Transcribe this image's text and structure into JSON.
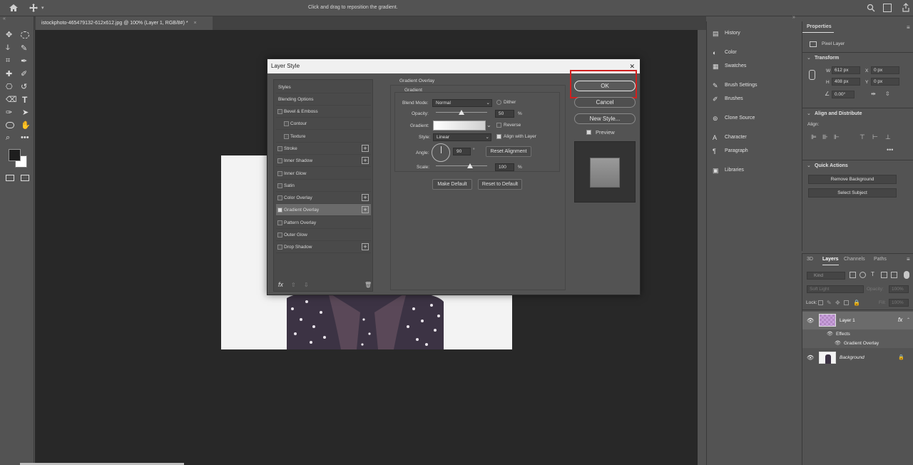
{
  "option_bar": {
    "hint": "Click and drag to reposition the gradient.",
    "icons": [
      "home-icon",
      "move-icon",
      "search-icon",
      "workspace-icon",
      "share-icon"
    ]
  },
  "document": {
    "tab_title": "istockphoto-465479132-612x612.jpg @ 100% (Layer 1, RGB/8#) *",
    "close": "×"
  },
  "dialog": {
    "title": "Layer Style",
    "close": "✕",
    "styles_header": "Styles",
    "blending_options": "Blending Options",
    "style_items": [
      {
        "label": "Bevel & Emboss",
        "checked": false,
        "plus": false,
        "indent": false
      },
      {
        "label": "Contour",
        "checked": false,
        "plus": false,
        "indent": true
      },
      {
        "label": "Texture",
        "checked": false,
        "plus": false,
        "indent": true
      },
      {
        "label": "Stroke",
        "checked": false,
        "plus": true,
        "indent": false
      },
      {
        "label": "Inner Shadow",
        "checked": false,
        "plus": true,
        "indent": false
      },
      {
        "label": "Inner Glow",
        "checked": false,
        "plus": false,
        "indent": false
      },
      {
        "label": "Satin",
        "checked": false,
        "plus": false,
        "indent": false
      },
      {
        "label": "Color Overlay",
        "checked": false,
        "plus": true,
        "indent": false
      },
      {
        "label": "Gradient Overlay",
        "checked": true,
        "plus": true,
        "indent": false
      },
      {
        "label": "Pattern Overlay",
        "checked": false,
        "plus": false,
        "indent": false
      },
      {
        "label": "Outer Glow",
        "checked": false,
        "plus": false,
        "indent": false
      },
      {
        "label": "Drop Shadow",
        "checked": false,
        "plus": true,
        "indent": false
      }
    ],
    "fx_label": "fx",
    "section_title": "Gradient Overlay",
    "group_title": "Gradient",
    "blend_mode_label": "Blend Mode:",
    "blend_mode_value": "Normal",
    "dither_label": "Dither",
    "opacity_label": "Opacity:",
    "opacity_value": "50",
    "opacity_fraction": 0.5,
    "percent": "%",
    "gradient_label": "Gradient:",
    "reverse_label": "Reverse",
    "style_label": "Style:",
    "style_value": "Linear",
    "align_label": "Align with Layer",
    "align_checked": true,
    "angle_label": "Angle:",
    "angle_value": "90",
    "degree": "°",
    "reset_alignment": "Reset Alignment",
    "scale_label": "Scale:",
    "scale_value": "100",
    "scale_fraction": 0.67,
    "make_default": "Make Default",
    "reset_default": "Reset to Default",
    "ok": "OK",
    "cancel": "Cancel",
    "new_style": "New Style...",
    "preview_label": "Preview",
    "preview_checked": true,
    "highlight_color": "#d0201f"
  },
  "dock": {
    "items": [
      {
        "label": "History",
        "icon": "history-icon",
        "glyph": "▤"
      },
      {
        "label": "Color",
        "icon": "color-icon",
        "glyph": "◐"
      },
      {
        "label": "Swatches",
        "icon": "swatches-icon",
        "glyph": "▦"
      },
      {
        "label": "Brush Settings",
        "icon": "brush-settings-icon",
        "glyph": "✎"
      },
      {
        "label": "Brushes",
        "icon": "brushes-icon",
        "glyph": "✐"
      },
      {
        "label": "Clone Source",
        "icon": "clone-source-icon",
        "glyph": "⊚"
      },
      {
        "label": "Character",
        "icon": "character-icon",
        "glyph": "A"
      },
      {
        "label": "Paragraph",
        "icon": "paragraph-icon",
        "glyph": "¶"
      },
      {
        "label": "Libraries",
        "icon": "libraries-icon",
        "glyph": "▣"
      }
    ]
  },
  "properties": {
    "tab": "Properties",
    "kind": "Pixel Layer",
    "transform_title": "Transform",
    "w_label": "W",
    "w_value": "612 px",
    "h_label": "H",
    "h_value": "408 px",
    "x_label": "X",
    "x_value": "0 px",
    "y_label": "Y",
    "y_value": "0 px",
    "angle_value": "0.00°",
    "align_title": "Align and Distribute",
    "align_label": "Align:",
    "quick_title": "Quick Actions",
    "remove_bg": "Remove Background",
    "select_subject": "Select Subject"
  },
  "layers": {
    "tabs": [
      "3D",
      "Layers",
      "Channels",
      "Paths"
    ],
    "active_tab": "Layers",
    "kind_placeholder": "Kind",
    "blend": "Soft Light",
    "opacity_label": "Opacity:",
    "opacity_value": "100%",
    "lock_label": "Lock:",
    "fill_label": "Fill:",
    "fill_value": "100%",
    "layer1": "Layer 1",
    "effects": "Effects",
    "gradient_overlay": "Gradient Overlay",
    "background": "Background",
    "fx": "fx"
  }
}
